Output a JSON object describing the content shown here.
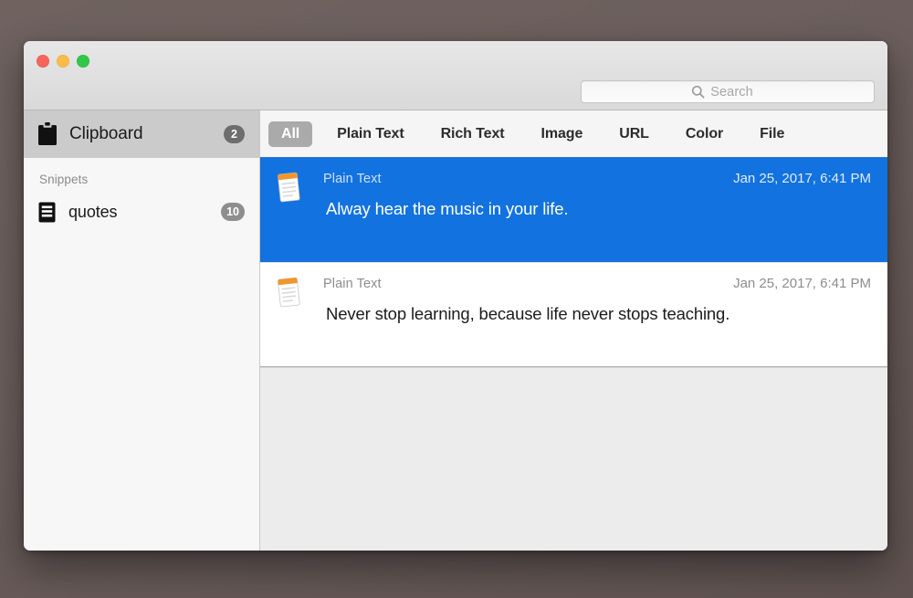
{
  "window": {
    "traffic_lights": [
      {
        "name": "close",
        "color": "#f5655b"
      },
      {
        "name": "minimize",
        "color": "#f7bd48"
      },
      {
        "name": "zoom",
        "color": "#31c748"
      }
    ],
    "backdrop_color": "#6b5e5c"
  },
  "search": {
    "icon": "search-icon",
    "placeholder": "Search",
    "value": ""
  },
  "sidebar": {
    "header": {
      "icon": "clipboard-icon",
      "label": "Clipboard",
      "badge": "2",
      "selected": true
    },
    "section_label": "Snippets",
    "items": [
      {
        "icon": "document-lines-icon",
        "label": "quotes",
        "badge": "10",
        "selected": false
      }
    ]
  },
  "filters": {
    "accent_color": "#1272e0",
    "tabs": [
      {
        "label": "All",
        "active": true
      },
      {
        "label": "Plain Text",
        "active": false
      },
      {
        "label": "Rich Text",
        "active": false
      },
      {
        "label": "Image",
        "active": false
      },
      {
        "label": "URL",
        "active": false
      },
      {
        "label": "Color",
        "active": false
      },
      {
        "label": "File",
        "active": false
      }
    ]
  },
  "clipboard_list": {
    "items": [
      {
        "icon": "plain-text-note-icon",
        "type": "Plain Text",
        "date": "Jan 25, 2017, 6:41 PM",
        "text": "Alway hear the music in your life.",
        "selected": true
      },
      {
        "icon": "plain-text-note-icon",
        "type": "Plain Text",
        "date": "Jan 25, 2017, 6:41 PM",
        "text": "Never stop learning, because life never stops teaching.",
        "selected": false
      }
    ]
  }
}
